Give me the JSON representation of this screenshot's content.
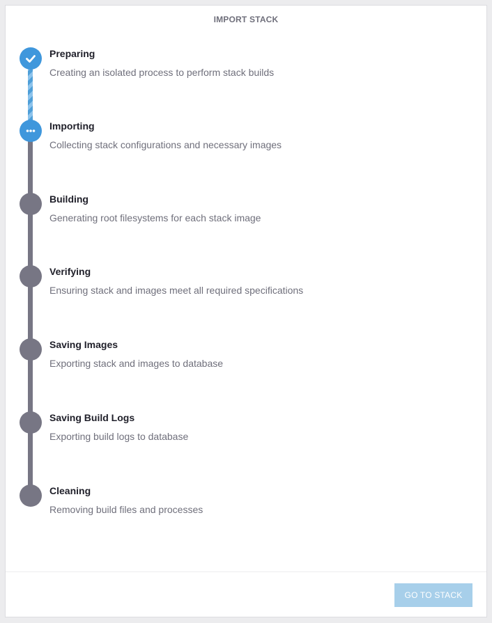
{
  "panel": {
    "title": "IMPORT STACK"
  },
  "steps": [
    {
      "title": "Preparing",
      "description": "Creating an isolated process to perform stack builds",
      "status": "done",
      "icon": "check-icon"
    },
    {
      "title": "Importing",
      "description": "Collecting stack configurations and necessary images",
      "status": "active",
      "icon": "ellipsis-icon"
    },
    {
      "title": "Building",
      "description": "Generating root filesystems for each stack image",
      "status": "pending",
      "icon": ""
    },
    {
      "title": "Verifying",
      "description": "Ensuring stack and images meet all required specifications",
      "status": "pending",
      "icon": ""
    },
    {
      "title": "Saving Images",
      "description": "Exporting stack and images to database",
      "status": "pending",
      "icon": ""
    },
    {
      "title": "Saving Build Logs",
      "description": "Exporting build logs to database",
      "status": "pending",
      "icon": ""
    },
    {
      "title": "Cleaning",
      "description": "Removing build files and processes",
      "status": "pending",
      "icon": ""
    }
  ],
  "footer": {
    "go_to_stack_label": "GO TO STACK",
    "go_to_stack_disabled": true
  },
  "colors": {
    "accent": "#3f97dc",
    "pending": "#777684",
    "button_disabled": "#a7cfea"
  }
}
